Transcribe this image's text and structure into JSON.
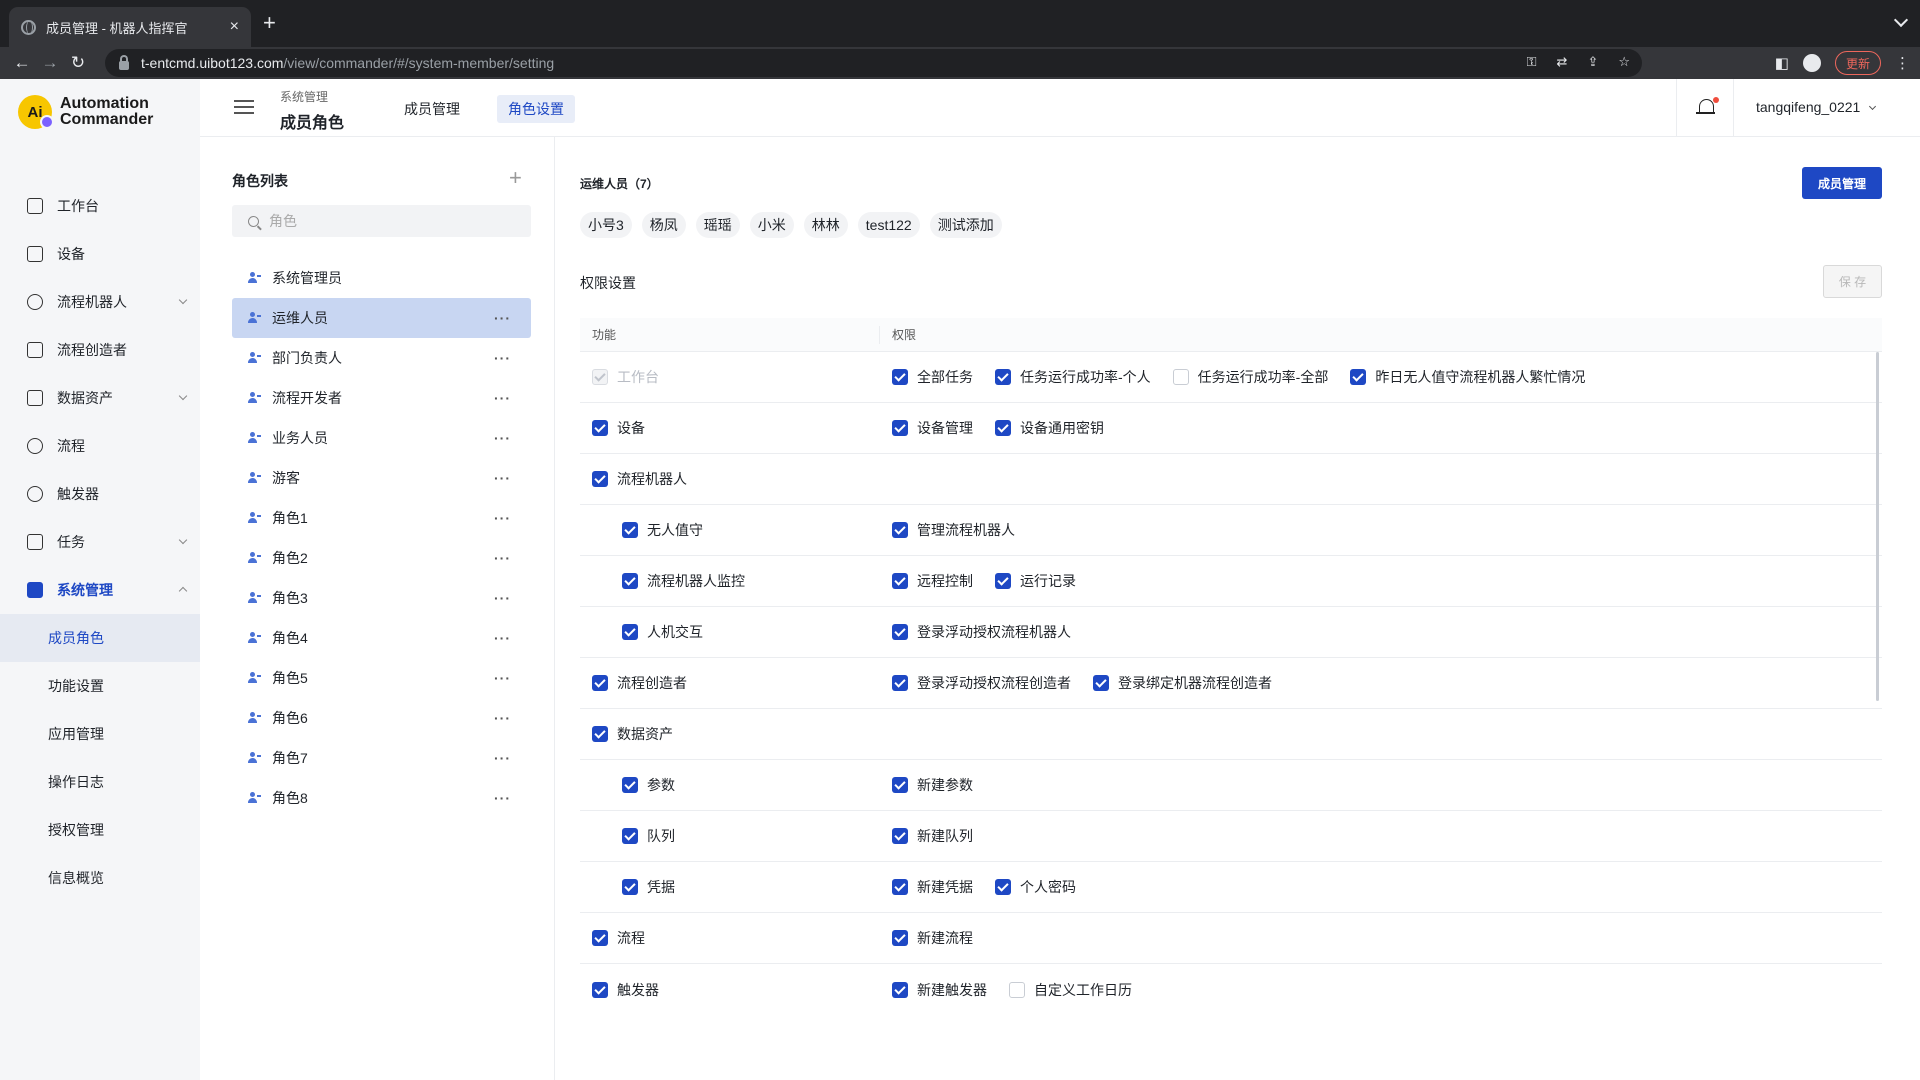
{
  "browser": {
    "tab_title": "成员管理 - 机器人指挥官",
    "close": "×",
    "new_tab": "+",
    "url_host": "t-entcmd.uibot123.com",
    "url_path": "/view/commander/#/system-member/setting",
    "update_label": "更新"
  },
  "sidebar": {
    "logo_line1": "Automation",
    "logo_line2": "Commander",
    "logo_mark": "Ai",
    "items": [
      {
        "label": "工作台",
        "icon": "dashboard-icon"
      },
      {
        "label": "设备",
        "icon": "device-icon"
      },
      {
        "label": "流程机器人",
        "icon": "robot-icon"
      },
      {
        "label": "流程创造者",
        "icon": "creator-icon"
      },
      {
        "label": "数据资产",
        "icon": "folder-icon"
      },
      {
        "label": "流程",
        "icon": "flow-icon"
      },
      {
        "label": "触发器",
        "icon": "trigger-icon"
      },
      {
        "label": "任务",
        "icon": "task-icon"
      },
      {
        "label": "系统管理",
        "icon": "system-icon"
      }
    ],
    "sub_items": [
      "成员角色",
      "功能设置",
      "应用管理",
      "操作日志",
      "授权管理",
      "信息概览"
    ]
  },
  "header": {
    "crumb_parent": "系统管理",
    "crumb_current": "成员角色",
    "tabs": [
      "成员管理",
      "角色设置"
    ],
    "user": "tangqifeng_0221"
  },
  "roles": {
    "title": "角色列表",
    "add": "+",
    "search_placeholder": "角色",
    "items": [
      "系统管理员",
      "运维人员",
      "部门负责人",
      "流程开发者",
      "业务人员",
      "游客",
      "角色1",
      "角色2",
      "角色3",
      "角色4",
      "角色5",
      "角色6",
      "角色7",
      "角色8"
    ],
    "more": "···"
  },
  "main": {
    "role_title": "运维人员（7）",
    "member_button": "成员管理",
    "members": [
      "小号3",
      "杨凤",
      "瑶瑶",
      "小米",
      "林林",
      "test122",
      "测试添加"
    ],
    "perm_title": "权限设置",
    "save": "保 存",
    "col_function": "功能",
    "col_permission": "权限",
    "rows": [
      {
        "func": "工作台",
        "perms": [
          "全部任务",
          "任务运行成功率-个人",
          "任务运行成功率-全部",
          "昨日无人值守流程机器人繁忙情况"
        ]
      },
      {
        "func": "设备",
        "perms": [
          "设备管理",
          "设备通用密钥"
        ]
      },
      {
        "func": "流程机器人",
        "perms": []
      },
      {
        "func": "无人值守",
        "perms": [
          "管理流程机器人"
        ]
      },
      {
        "func": "流程机器人监控",
        "perms": [
          "远程控制",
          "运行记录"
        ]
      },
      {
        "func": "人机交互",
        "perms": [
          "登录浮动授权流程机器人"
        ]
      },
      {
        "func": "流程创造者",
        "perms": [
          "登录浮动授权流程创造者",
          "登录绑定机器流程创造者"
        ]
      },
      {
        "func": "数据资产",
        "perms": []
      },
      {
        "func": "参数",
        "perms": [
          "新建参数"
        ]
      },
      {
        "func": "队列",
        "perms": [
          "新建队列"
        ]
      },
      {
        "func": "凭据",
        "perms": [
          "新建凭据",
          "个人密码"
        ]
      },
      {
        "func": "流程",
        "perms": [
          "新建流程"
        ]
      },
      {
        "func": "触发器",
        "perms": [
          "新建触发器",
          "自定义工作日历"
        ]
      }
    ]
  },
  "colors": {
    "accent": "#1e48c4",
    "selected_role_bg": "#c8d6f2"
  }
}
